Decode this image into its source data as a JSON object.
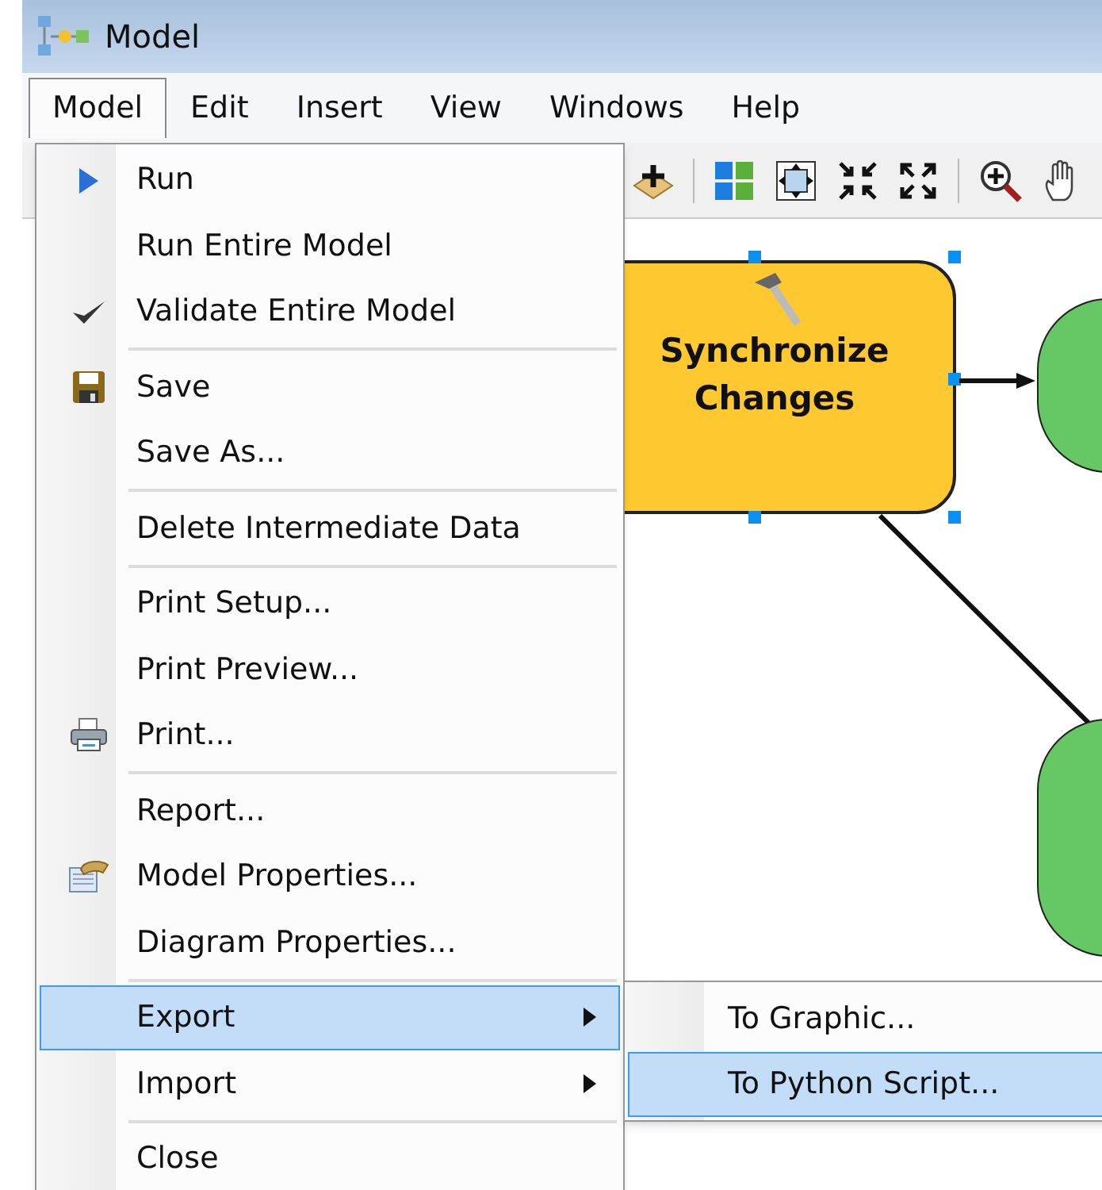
{
  "window": {
    "title": "Model"
  },
  "menubar": [
    {
      "label": "Model",
      "selected": true
    },
    {
      "label": "Edit",
      "selected": false
    },
    {
      "label": "Insert",
      "selected": false
    },
    {
      "label": "View",
      "selected": false
    },
    {
      "label": "Windows",
      "selected": false
    },
    {
      "label": "Help",
      "selected": false
    }
  ],
  "menu": {
    "items": [
      {
        "kind": "run",
        "label": "Run",
        "selected": false,
        "submenu": false
      },
      {
        "kind": "plain",
        "label": "Run Entire Model",
        "selected": false,
        "submenu": false
      },
      {
        "kind": "validate",
        "label": "Validate Entire Model",
        "selected": false,
        "submenu": false
      },
      {
        "kind": "separator"
      },
      {
        "kind": "save",
        "label": "Save",
        "selected": false,
        "submenu": false
      },
      {
        "kind": "plain",
        "label": "Save As...",
        "selected": false,
        "submenu": false
      },
      {
        "kind": "separator"
      },
      {
        "kind": "plain",
        "label": "Delete Intermediate Data",
        "selected": false,
        "submenu": false
      },
      {
        "kind": "separator"
      },
      {
        "kind": "plain",
        "label": "Print Setup...",
        "selected": false,
        "submenu": false
      },
      {
        "kind": "plain",
        "label": "Print Preview...",
        "selected": false,
        "submenu": false
      },
      {
        "kind": "print",
        "label": "Print...",
        "selected": false,
        "submenu": false
      },
      {
        "kind": "separator"
      },
      {
        "kind": "plain",
        "label": "Report...",
        "selected": false,
        "submenu": false
      },
      {
        "kind": "properties",
        "label": "Model Properties...",
        "selected": false,
        "submenu": false
      },
      {
        "kind": "plain",
        "label": "Diagram Properties...",
        "selected": false,
        "submenu": false
      },
      {
        "kind": "separator"
      },
      {
        "kind": "plain",
        "label": "Export",
        "selected": true,
        "submenu": true
      },
      {
        "kind": "plain",
        "label": "Import",
        "selected": false,
        "submenu": true
      },
      {
        "kind": "separator"
      },
      {
        "kind": "plain",
        "label": "Close",
        "selected": false,
        "submenu": false
      }
    ]
  },
  "submenu": {
    "items": [
      {
        "label": "To Graphic...",
        "selected": false
      },
      {
        "label": "To Python Script...",
        "selected": true
      }
    ]
  },
  "canvas": {
    "tool": {
      "label": "Synchronize Changes",
      "selected": true
    }
  }
}
